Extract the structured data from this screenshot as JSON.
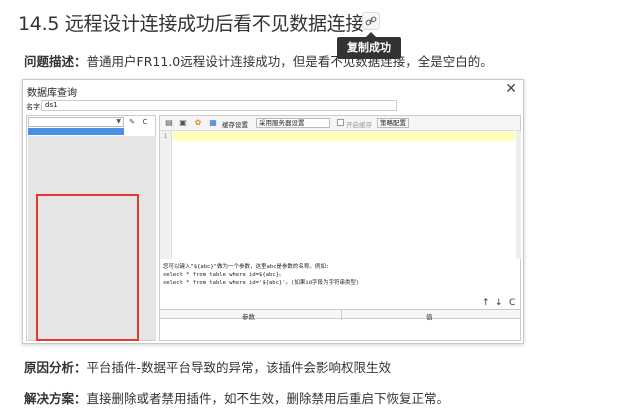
{
  "article": {
    "heading": "14.5 远程设计连接成功后看不见数据连接",
    "tooltip": "复制成功",
    "problem_label": "问题描述：",
    "problem_text": "普通用户FR11.0远程设计连接成功，但是看不见数据连接，全是空白的。",
    "cause_label": "原因分析：",
    "cause_text": "平台插件-数据平台导致的异常，该插件会影响权限生效",
    "solution_label": "解决方案：",
    "solution_text": "直接删除或者禁用插件，如不生效，删除禁用后重启下恢复正常。"
  },
  "dialog": {
    "title": "数据库查询",
    "close": "✕",
    "name_label": "名字:",
    "name_value": "ds1",
    "toolbar": {
      "cache_settings": "缓存设置",
      "server_setting": "采用服务器设置",
      "enable_cache": "开启缓存",
      "strategy": "策略配置"
    },
    "line_number": "1",
    "hint_lines": "您可以键入\"${abc}\"做为一个参数，这里abc是参数的名称。例如:\nselect * from table where id=${abc}。\nselect * from table where id='${abc}'。(如果id字段为字符串类型)",
    "nav": [
      "↑",
      "↓",
      "C"
    ],
    "param_columns": [
      "参数",
      "值"
    ]
  },
  "colors": {
    "highlight": "#e23b2e",
    "selection": "#4a90e2",
    "editor_line": "#ffffb8"
  }
}
